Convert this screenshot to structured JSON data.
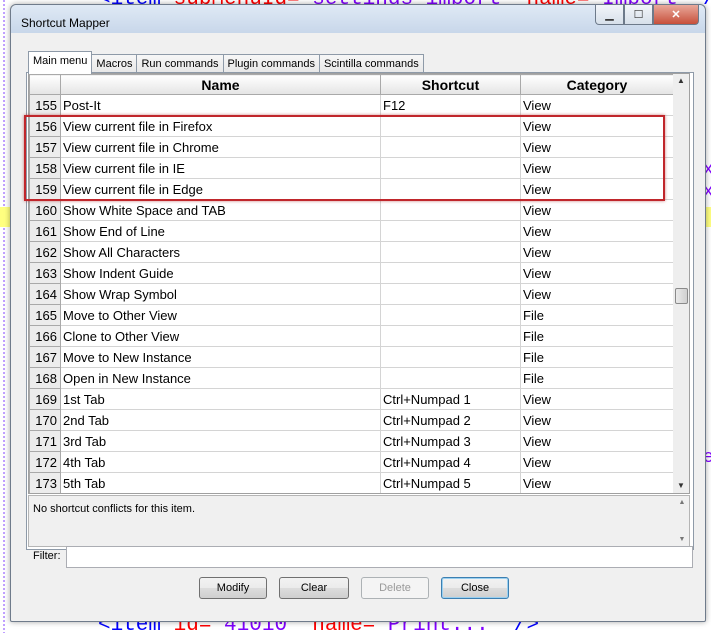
{
  "background": {
    "top_line": {
      "tag": "<item",
      "attr1": "subMenuId=",
      "val1": "\"settings-import\"",
      "attr2": "name=",
      "val2": "\"Import\"",
      "end": "/>"
    },
    "bottom_line": {
      "tag": "<item",
      "attr1": "id=",
      "val1": "\"41010\"",
      "attr2": "name=",
      "val2": "\"Print...\"",
      "end": "/>"
    },
    "side_fragments": [
      "x",
      "x",
      "e"
    ]
  },
  "window": {
    "title": "Shortcut Mapper",
    "controls": {
      "minimize": "▁",
      "maximize": "☐",
      "close": "✕"
    }
  },
  "tabs": [
    {
      "label": "Main menu",
      "active": true
    },
    {
      "label": "Macros",
      "active": false
    },
    {
      "label": "Run commands",
      "active": false
    },
    {
      "label": "Plugin commands",
      "active": false
    },
    {
      "label": "Scintilla commands",
      "active": false
    }
  ],
  "grid": {
    "columns": [
      "",
      "Name",
      "Shortcut",
      "Category"
    ],
    "rows": [
      {
        "num": "155",
        "name": "Post-It",
        "shortcut": "F12",
        "category": "View"
      },
      {
        "num": "156",
        "name": "View current file in Firefox",
        "shortcut": "",
        "category": "View"
      },
      {
        "num": "157",
        "name": "View current file in Chrome",
        "shortcut": "",
        "category": "View"
      },
      {
        "num": "158",
        "name": "View current file in IE",
        "shortcut": "",
        "category": "View"
      },
      {
        "num": "159",
        "name": "View current file in Edge",
        "shortcut": "",
        "category": "View"
      },
      {
        "num": "160",
        "name": "Show White Space and TAB",
        "shortcut": "",
        "category": "View"
      },
      {
        "num": "161",
        "name": "Show End of Line",
        "shortcut": "",
        "category": "View"
      },
      {
        "num": "162",
        "name": "Show All Characters",
        "shortcut": "",
        "category": "View"
      },
      {
        "num": "163",
        "name": "Show Indent Guide",
        "shortcut": "",
        "category": "View"
      },
      {
        "num": "164",
        "name": "Show Wrap Symbol",
        "shortcut": "",
        "category": "View"
      },
      {
        "num": "165",
        "name": "Move to Other View",
        "shortcut": "",
        "category": "File"
      },
      {
        "num": "166",
        "name": "Clone to Other View",
        "shortcut": "",
        "category": "File"
      },
      {
        "num": "167",
        "name": "Move to New Instance",
        "shortcut": "",
        "category": "File"
      },
      {
        "num": "168",
        "name": "Open in New Instance",
        "shortcut": "",
        "category": "File"
      },
      {
        "num": "169",
        "name": "1st Tab",
        "shortcut": "Ctrl+Numpad 1",
        "category": "View"
      },
      {
        "num": "170",
        "name": "2nd Tab",
        "shortcut": "Ctrl+Numpad 2",
        "category": "View"
      },
      {
        "num": "171",
        "name": "3rd Tab",
        "shortcut": "Ctrl+Numpad 3",
        "category": "View"
      },
      {
        "num": "172",
        "name": "4th Tab",
        "shortcut": "Ctrl+Numpad 4",
        "category": "View"
      },
      {
        "num": "173",
        "name": "5th Tab",
        "shortcut": "Ctrl+Numpad 5",
        "category": "View"
      }
    ],
    "scroll_up_icon": "▲",
    "scroll_down_icon": "▼"
  },
  "highlight": {
    "color": "#c0262b"
  },
  "conflict_panel": {
    "text": "No shortcut conflicts for this item.",
    "up_icon": "▲",
    "down_icon": "▼"
  },
  "filter": {
    "label": "Filter:",
    "value": ""
  },
  "buttons": {
    "modify": "Modify",
    "clear": "Clear",
    "delete": "Delete",
    "close": "Close"
  }
}
